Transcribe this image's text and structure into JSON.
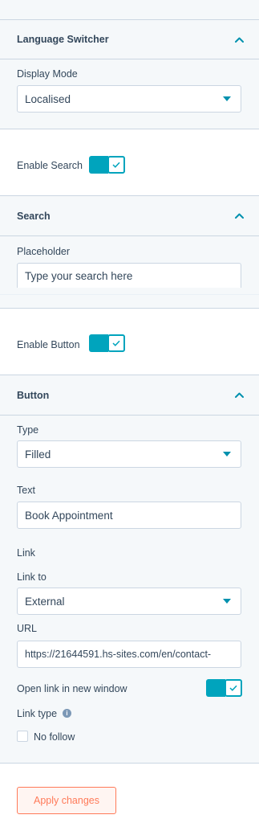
{
  "language_switcher": {
    "header": "Language Switcher",
    "display_mode_label": "Display Mode",
    "display_mode_value": "Localised"
  },
  "enable_search": {
    "label": "Enable Search",
    "on": true
  },
  "search": {
    "header": "Search",
    "placeholder_label": "Placeholder",
    "placeholder_value": "Type your search here"
  },
  "enable_button": {
    "label": "Enable Button",
    "on": true
  },
  "button": {
    "header": "Button",
    "type_label": "Type",
    "type_value": "Filled",
    "text_label": "Text",
    "text_value": "Book Appointment",
    "link_heading": "Link",
    "link_to_label": "Link to",
    "link_to_value": "External",
    "url_label": "URL",
    "url_value": "https://21644591.hs-sites.com/en/contact-",
    "open_new_window_label": "Open link in new window",
    "open_new_window_on": true,
    "link_type_label": "Link type",
    "no_follow_label": "No follow",
    "no_follow_checked": false
  },
  "footer": {
    "apply_label": "Apply changes"
  },
  "colors": {
    "accent": "#00a4bd",
    "caret": "#0091ae",
    "text": "#33475b",
    "border": "#cbd6e2",
    "panel_bg": "#f5f8fa",
    "cta": "#ff7a59"
  },
  "icons": {
    "collapse": "chevron-up-icon",
    "dropdown": "caret-down-icon",
    "toggle": "check-icon",
    "info": "info-icon"
  }
}
